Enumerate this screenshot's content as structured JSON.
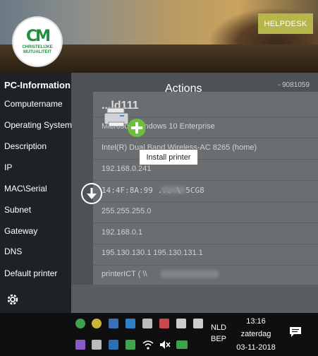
{
  "header": {
    "logo_mark": "CM",
    "logo_text_line1": "CHRISTELIJKE",
    "logo_text_line2": "MUTUALITEIT",
    "helpdesk_label": "HELPDESK"
  },
  "sidebar": {
    "title": "PC-Information",
    "labels": [
      "Computername",
      "Operating System",
      "Description",
      "IP",
      "MAC\\Serial",
      "Subnet",
      "Gateway",
      "DNS",
      "Default printer"
    ]
  },
  "values": {
    "serial_top": "- 9081059",
    "computername": "...ld111",
    "os": "Microsoft Windows 10 Enterprise",
    "description": "Intel(R) Dual Band Wireless-AC 8265 (home)",
    "ip": "192.168.0.241",
    "mac_serial": "14:4F:8A:99 ... \\ 5CG8",
    "subnet": "255.255.255.0",
    "gateway": "192.168.0.1",
    "dns": "195.130.130.1 195.130.131.1",
    "default_printer": "printerICT ( \\\\"
  },
  "actions": {
    "title": "Actions",
    "tooltip": "Install printer"
  },
  "taskbar": {
    "language_line1": "NLD",
    "language_line2": "BEP",
    "time": "13:16",
    "day": "zaterdag",
    "date": "03-11-2018"
  },
  "colors": {
    "helpdesk_bg": "#b7b64a",
    "accent_green": "#6fbf3f",
    "sidebar_bg": "#1f2224"
  }
}
